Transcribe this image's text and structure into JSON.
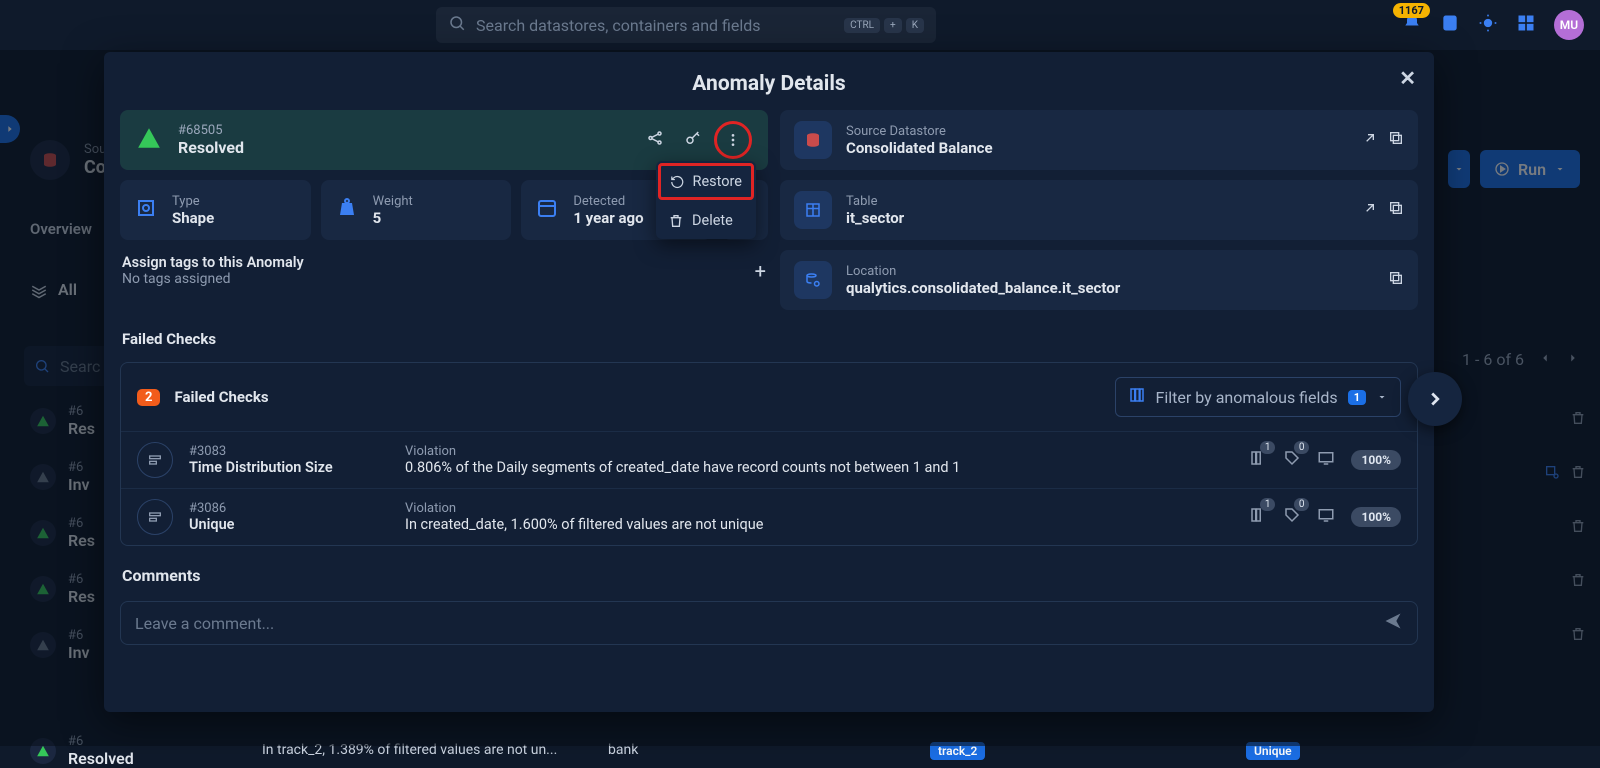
{
  "topbar": {
    "search_placeholder": "Search datastores, containers and fields",
    "kbd1": "CTRL",
    "kbd_plus": "+",
    "kbd2": "K",
    "bell_count": "1167",
    "avatar": "MU"
  },
  "bg": {
    "brand_small": "Sou",
    "brand_big": "Co",
    "overview": "Overview",
    "all": "All",
    "search_label": "Searc",
    "run": "Run",
    "pager": "1 - 6 of 6",
    "rows": [
      {
        "id": "#6",
        "status": "Res",
        "tri": "green"
      },
      {
        "id": "#6",
        "status": "Inv",
        "tri": "grey"
      },
      {
        "id": "#6",
        "status": "Res",
        "tri": "green"
      },
      {
        "id": "#6",
        "status": "Res",
        "tri": "green"
      },
      {
        "id": "#6",
        "status": "Inv",
        "tri": "grey"
      }
    ],
    "bottom_row": {
      "id": "#6",
      "status": "Resolved",
      "tri": "green"
    },
    "bottom_desc": "In track_2, 1.389% of filtered values are not un...",
    "bottom_col": "bank",
    "tag_track": "track_2",
    "tag_unique": "Unique"
  },
  "modal": {
    "title": "Anomaly Details",
    "status": {
      "id": "#68505",
      "label": "Resolved"
    },
    "popover": {
      "restore": "Restore",
      "delete": "Delete"
    },
    "metrics": {
      "type_label": "Type",
      "type_value": "Shape",
      "weight_label": "Weight",
      "weight_value": "5",
      "detected_label": "Detected",
      "detected_value": "1 year ago"
    },
    "source": {
      "label": "Source Datastore",
      "value": "Consolidated Balance"
    },
    "table": {
      "label": "Table",
      "value": "it_sector"
    },
    "location": {
      "label": "Location",
      "value": "qualytics.consolidated_balance.it_sector"
    },
    "tags": {
      "title": "Assign tags to this Anomaly",
      "empty": "No tags assigned"
    },
    "failed_section": "Failed Checks",
    "fc": {
      "count": "2",
      "head": "Failed Checks",
      "filter_label": "Filter by anomalous fields",
      "filter_count": "1",
      "rows": [
        {
          "id": "#3083",
          "name": "Time Distribution Size",
          "vlabel": "Violation",
          "desc": "0.806% of the Daily segments of created_date have record counts not between 1 and 1",
          "b1": "1",
          "b2": "0",
          "pct": "100%"
        },
        {
          "id": "#3086",
          "name": "Unique",
          "vlabel": "Violation",
          "desc": "In created_date, 1.600% of filtered values are not unique",
          "b1": "1",
          "b2": "0",
          "pct": "100%"
        }
      ]
    },
    "comments": {
      "title": "Comments",
      "placeholder": "Leave a comment..."
    }
  }
}
